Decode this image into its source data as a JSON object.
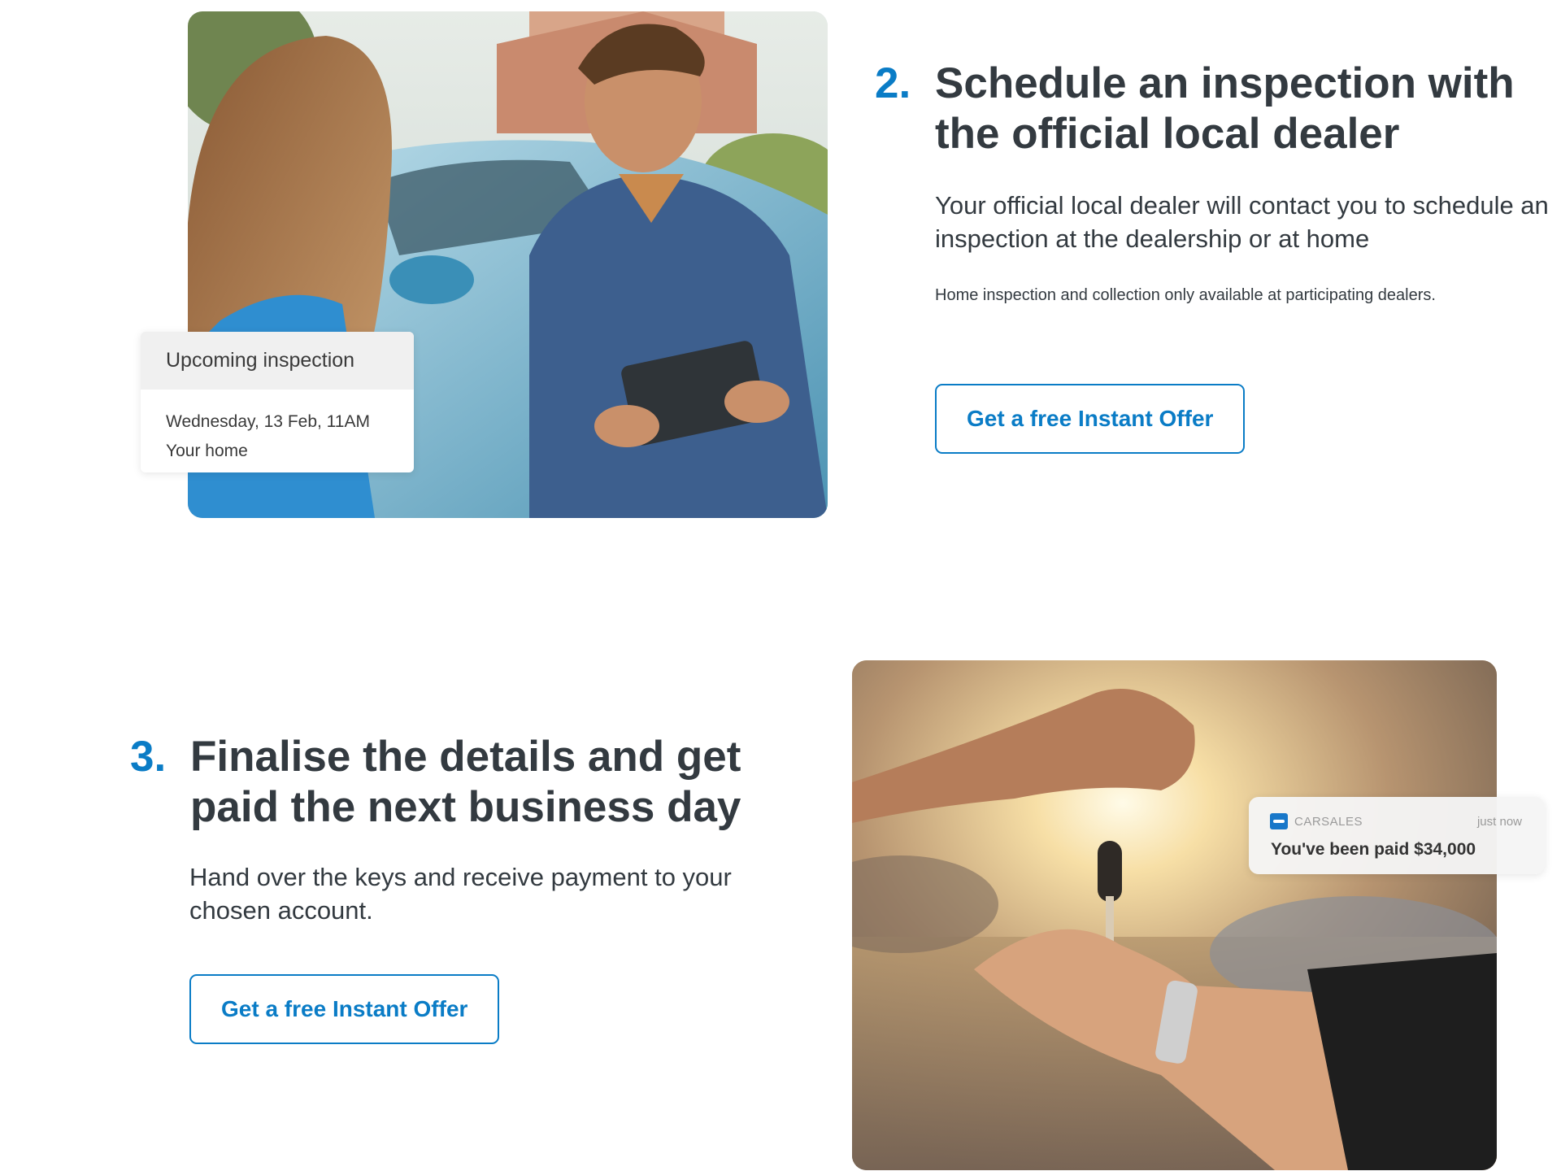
{
  "step2": {
    "number": "2.",
    "title": "Schedule an inspection with the official local dealer",
    "description": "Your official local dealer will contact you to schedule an inspection at the dealership or at home",
    "note": "Home inspection and collection only available at participating dealers.",
    "cta_label": "Get a free Instant Offer",
    "inspection_card": {
      "title": "Upcoming inspection",
      "date": "Wednesday, 13 Feb, 11AM",
      "location": "Your home"
    }
  },
  "step3": {
    "number": "3.",
    "title": "Finalise the details and get paid the next business day",
    "description": "Hand over the keys and receive payment to your chosen account.",
    "cta_label": "Get a free Instant Offer",
    "notification": {
      "app_name": "CARSALES",
      "time": "just now",
      "message": "You've been paid $34,000"
    }
  },
  "colors": {
    "accent": "#0a7cc6",
    "heading": "#333a40"
  }
}
